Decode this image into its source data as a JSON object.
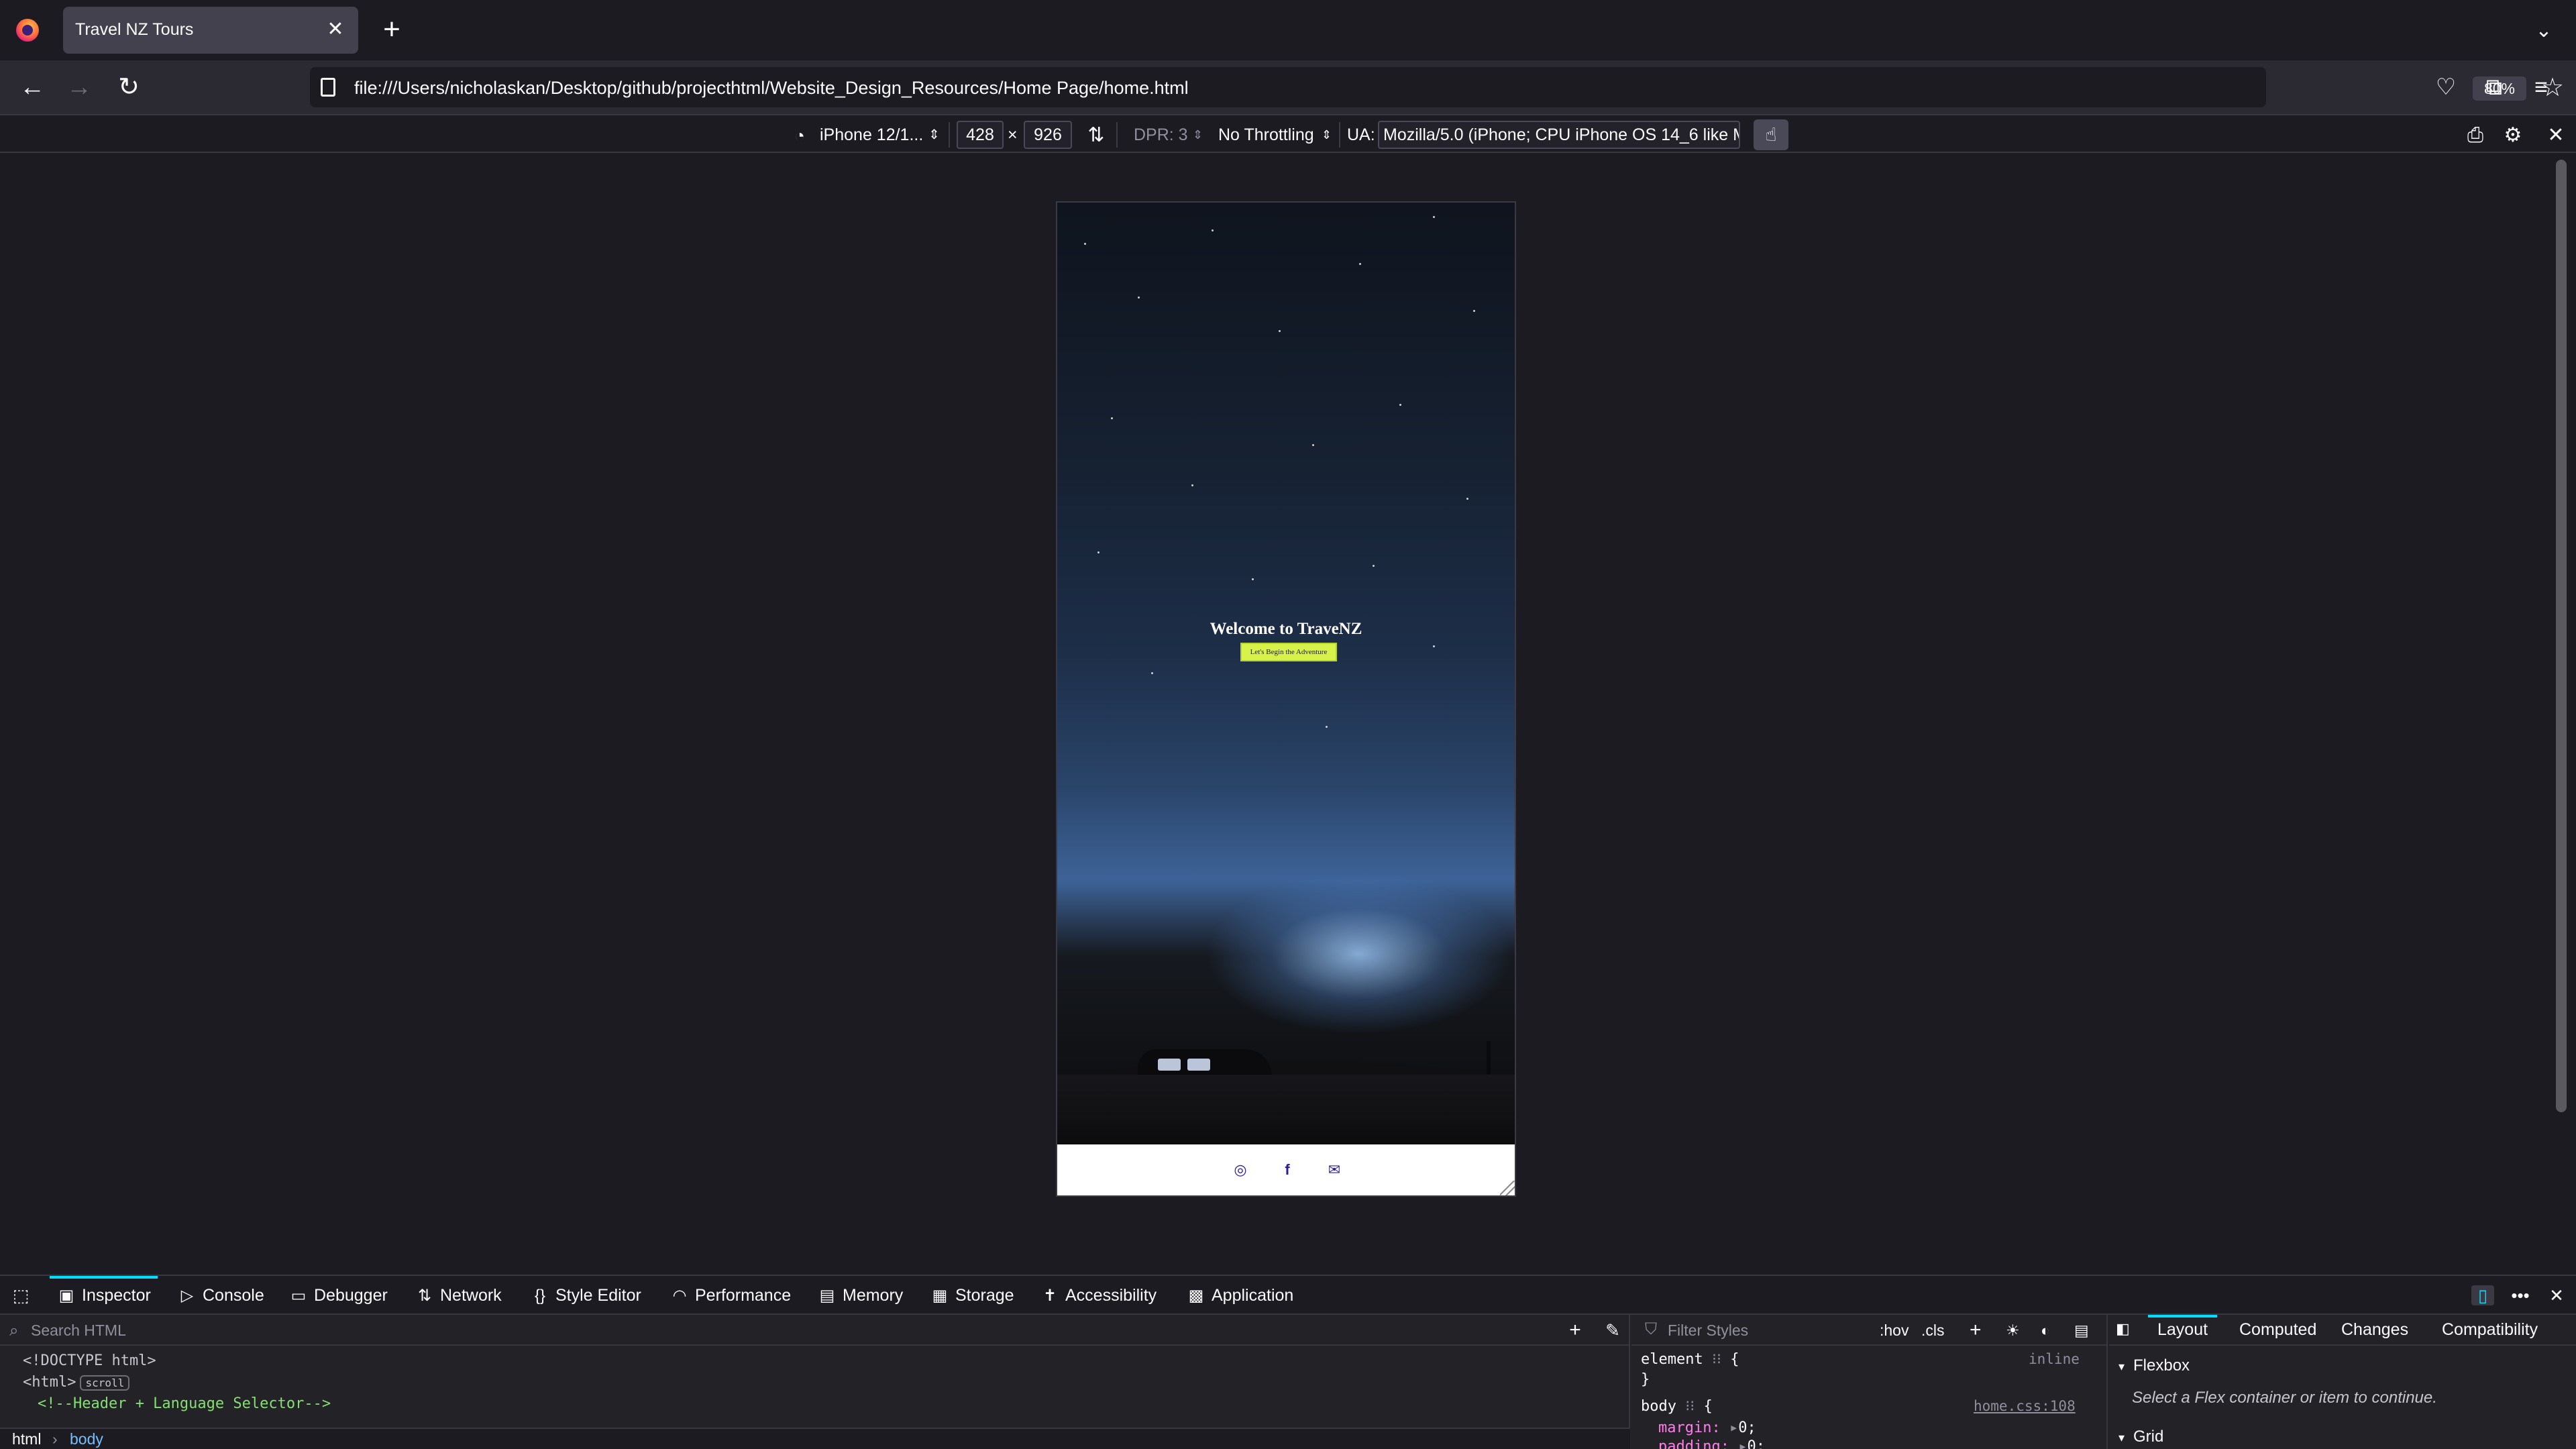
{
  "browser": {
    "tab_title": "Travel NZ Tours",
    "url": "file:///Users/nicholaskan/Desktop/github/projecthtml/Website_Design_Resources/Home Page/home.html",
    "zoom": "80%"
  },
  "rdm": {
    "device": "iPhone 12/1...",
    "width": "428",
    "times": "×",
    "height": "926",
    "dpr": "DPR: 3",
    "throttling": "No Throttling",
    "ua_label": "UA:",
    "ua_value": "Mozilla/5.0 (iPhone; CPU iPhone OS 14_6 like M"
  },
  "page": {
    "hero_title": "Welcome to TraveNZ",
    "hero_button": "Let's Begin the Adventure",
    "social": [
      "instagram-icon",
      "facebook-icon",
      "email-icon"
    ]
  },
  "devtools": {
    "tabs": [
      {
        "label": "Inspector",
        "icon": "inspector-icon"
      },
      {
        "label": "Console",
        "icon": "console-icon"
      },
      {
        "label": "Debugger",
        "icon": "debugger-icon"
      },
      {
        "label": "Network",
        "icon": "network-icon"
      },
      {
        "label": "Style Editor",
        "icon": "style-editor-icon"
      },
      {
        "label": "Performance",
        "icon": "performance-icon"
      },
      {
        "label": "Memory",
        "icon": "memory-icon"
      },
      {
        "label": "Storage",
        "icon": "storage-icon"
      },
      {
        "label": "Accessibility",
        "icon": "accessibility-icon"
      },
      {
        "label": "Application",
        "icon": "application-icon"
      }
    ],
    "search_placeholder": "Search HTML",
    "html_lines": {
      "doctype": "<!DOCTYPE html>",
      "html_open": "<html>",
      "scroll_badge": "scroll",
      "comment": "<!--Header + Language Selector-->"
    },
    "breadcrumbs": [
      "html",
      "body"
    ],
    "rules": {
      "filter_placeholder": "Filter Styles",
      "hov": ":hov",
      "cls": ".cls",
      "element_selector": "element",
      "element_brace_open": "{",
      "element_brace_close": "}",
      "element_source": "inline",
      "body_selector": "body",
      "body_brace_open": "{",
      "body_source": "home.css:108",
      "margin_prop": "margin:",
      "margin_val": "0;",
      "padding_prop": "padding:",
      "padding_val": "0;"
    },
    "layout": {
      "tabs": [
        "Layout",
        "Computed",
        "Changes",
        "Compatibility"
      ],
      "flexbox_title": "Flexbox",
      "flexbox_hint": "Select a Flex container or item to continue.",
      "grid_title": "Grid"
    }
  },
  "colors": {
    "accent": "#00ddff",
    "hero_button_bg": "#d7f34a",
    "social_icon": "#2d1d9a"
  }
}
